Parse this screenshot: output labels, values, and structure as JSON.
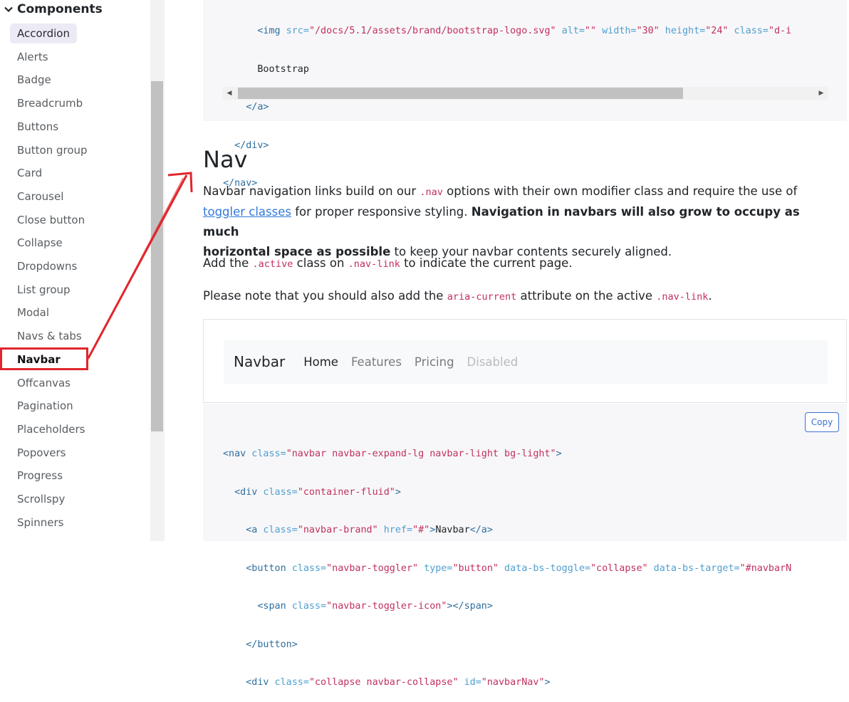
{
  "sidebar": {
    "heading": "Components",
    "items": [
      {
        "label": "Accordion",
        "state": "selected"
      },
      {
        "label": "Alerts"
      },
      {
        "label": "Badge"
      },
      {
        "label": "Breadcrumb"
      },
      {
        "label": "Buttons"
      },
      {
        "label": "Button group"
      },
      {
        "label": "Card"
      },
      {
        "label": "Carousel"
      },
      {
        "label": "Close button"
      },
      {
        "label": "Collapse"
      },
      {
        "label": "Dropdowns"
      },
      {
        "label": "List group"
      },
      {
        "label": "Modal"
      },
      {
        "label": "Navs & tabs"
      },
      {
        "label": "Navbar",
        "state": "current"
      },
      {
        "label": "Offcanvas"
      },
      {
        "label": "Pagination"
      },
      {
        "label": "Placeholders"
      },
      {
        "label": "Popovers"
      },
      {
        "label": "Progress"
      },
      {
        "label": "Scrollspy"
      },
      {
        "label": "Spinners"
      }
    ]
  },
  "top_code": {
    "l1_tag_open": "<img",
    "l1_src_attr": " src=",
    "l1_src_val": "\"/docs/5.1/assets/brand/bootstrap-logo.svg\"",
    "l1_alt_attr": " alt=",
    "l1_alt_val": "\"\"",
    "l1_w_attr": " width=",
    "l1_w_val": "\"30\"",
    "l1_h_attr": " height=",
    "l1_h_val": "\"24\"",
    "l1_c_attr": " class=",
    "l1_c_val": "\"d-i",
    "l2_text": "Bootstrap",
    "l3": "</a>",
    "l4": "</div>",
    "l5": "</nav>"
  },
  "section": {
    "heading": "Nav",
    "p1_a": "Navbar navigation links build on our ",
    "p1_code": ".nav",
    "p1_b": " options with their own modifier class and require the use of",
    "p1_link": "toggler classes",
    "p1_c": " for proper responsive styling. ",
    "p1_bold": "Navigation in navbars will also grow to occupy as much",
    "p1_bold2": "horizontal space as possible",
    "p1_d": " to keep your navbar contents securely aligned.",
    "p2_a": "Add the ",
    "p2_code1": ".active",
    "p2_b": " class on ",
    "p2_code2": ".nav-link",
    "p2_c": " to indicate the current page.",
    "p3_a": "Please note that you should also add the ",
    "p3_code1": "aria-current",
    "p3_b": " attribute on the active ",
    "p3_code2": ".nav-link",
    "p3_c": "."
  },
  "example": {
    "brand": "Navbar",
    "links": [
      {
        "label": "Home",
        "state": "active"
      },
      {
        "label": "Features"
      },
      {
        "label": "Pricing"
      },
      {
        "label": "Disabled",
        "state": "disabled"
      }
    ]
  },
  "bottom_code": {
    "copy_label": "Copy",
    "l1_tag": "<nav",
    "l1_attr": " class=",
    "l1_val": "\"navbar navbar-expand-lg navbar-light bg-light\"",
    "l1_end": ">",
    "l2_tag": "<div",
    "l2_attr": " class=",
    "l2_val": "\"container-fluid\"",
    "l2_end": ">",
    "l3_tag": "<a",
    "l3_attr": " class=",
    "l3_val": "\"navbar-brand\"",
    "l3_attr2": " href=",
    "l3_val2": "\"#\"",
    "l3_end": ">",
    "l3_text": "Navbar",
    "l3_close": "</a>",
    "l4_tag": "<button",
    "l4_attr": " class=",
    "l4_val": "\"navbar-toggler\"",
    "l4_attr2": " type=",
    "l4_val2": "\"button\"",
    "l4_attr3": " data-bs-toggle=",
    "l4_val3": "\"collapse\"",
    "l4_attr4": " data-bs-target=",
    "l4_val4": "\"#navbarN",
    "l5_tag": "<span",
    "l5_attr": " class=",
    "l5_val": "\"navbar-toggler-icon\"",
    "l5_end": ">",
    "l5_close": "</span>",
    "l6": "</button>",
    "l7_tag": "<div",
    "l7_attr": " class=",
    "l7_val": "\"collapse navbar-collapse\"",
    "l7_attr2": " id=",
    "l7_val2": "\"navbarNav\"",
    "l7_end": ">"
  },
  "icons": {
    "sidebar_chevron": "chevron-down-icon",
    "scroll_left": "triangle-left-icon",
    "scroll_right": "triangle-right-icon"
  },
  "colors": {
    "highlight": "#e0262c",
    "link": "#3278d8",
    "code_value": "#c0315d",
    "code_tag": "#2f6f9f"
  }
}
